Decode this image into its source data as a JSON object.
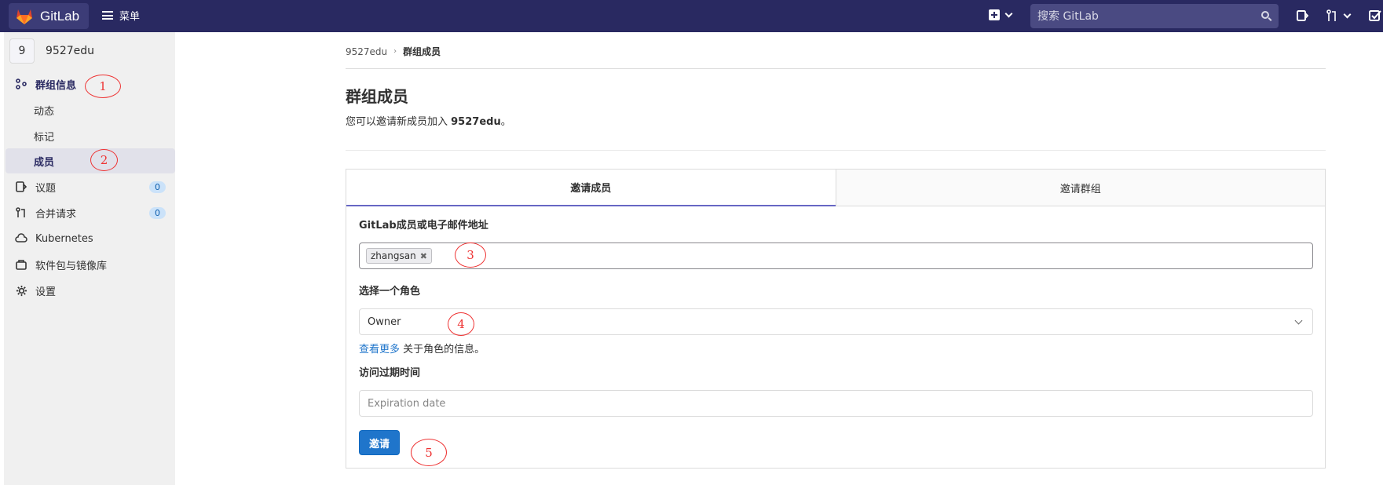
{
  "topbar": {
    "logo_text": "GitLab",
    "menu_label": "菜单",
    "search_placeholder": "搜索 GitLab",
    "icons": [
      "gitlab-tanuki-logo",
      "hamburger-icon",
      "plus-square-icon",
      "search-icon",
      "issues-icon",
      "merge-request-icon",
      "todo-icon"
    ]
  },
  "sidebar": {
    "group_avatar": "9",
    "group_name": "9527edu",
    "items": [
      {
        "label": "群组信息",
        "icon": "group-info-icon"
      },
      {
        "label": "动态"
      },
      {
        "label": "标记"
      },
      {
        "label": "成员"
      },
      {
        "label": "议题",
        "icon": "issues-icon",
        "count": "0"
      },
      {
        "label": "合并请求",
        "icon": "merge-request-icon",
        "count": "0"
      },
      {
        "label": "Kubernetes",
        "icon": "kubernetes-icon"
      },
      {
        "label": "软件包与镜像库",
        "icon": "package-icon"
      },
      {
        "label": "设置",
        "icon": "settings-icon"
      }
    ]
  },
  "breadcrumb": {
    "parent": "9527edu",
    "current": "群组成员"
  },
  "page": {
    "title": "群组成员",
    "subtitle_prefix": "您可以邀请新成员加入 ",
    "subtitle_group": "9527edu",
    "subtitle_suffix": "。"
  },
  "tabs": [
    "邀请成员",
    "邀请群组"
  ],
  "form": {
    "members_label": "GitLab成员或电子邮件地址",
    "member_token": "zhangsan",
    "role_label": "选择一个角色",
    "role_value": "Owner",
    "help_link": "查看更多",
    "help_text": " 关于角色的信息。",
    "expiry_label": "访问过期时间",
    "expiry_placeholder": "Expiration date",
    "invite_button": "邀请"
  },
  "annotations": [
    "1",
    "2",
    "3",
    "4",
    "5"
  ],
  "colors": {
    "topbar": "#292961",
    "accent": "#1f75cb",
    "callout": "#ee3333"
  }
}
